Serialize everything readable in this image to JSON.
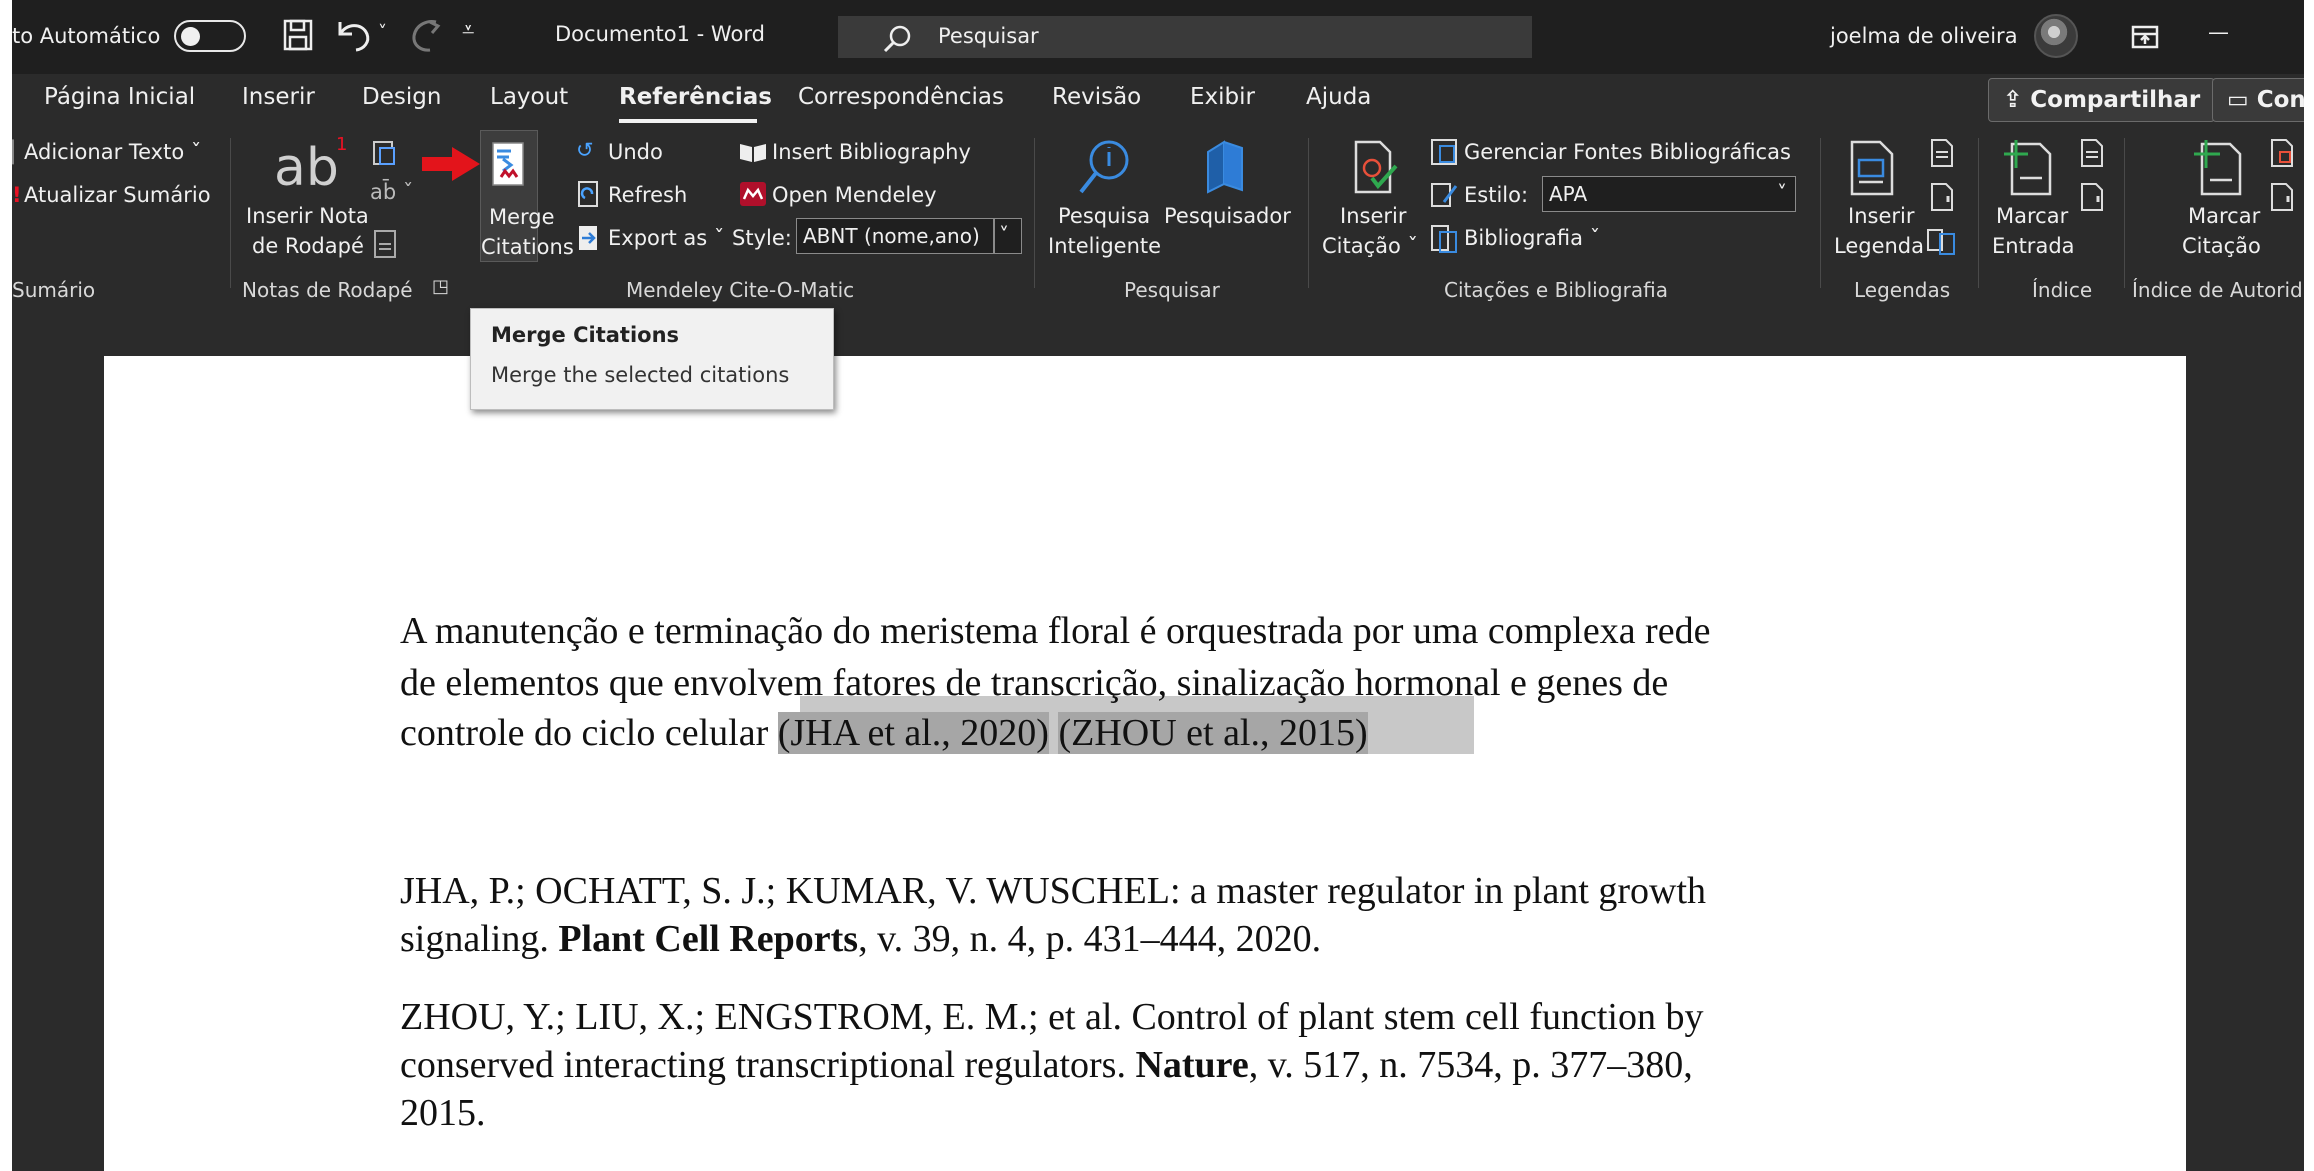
{
  "titlebar": {
    "autosave_label": "to Automático",
    "document_title": "Documento1  -  Word",
    "search_placeholder": "Pesquisar",
    "user_name": "joelma de oliveira",
    "minimize": "—"
  },
  "tabs": [
    {
      "label": "Página Inicial"
    },
    {
      "label": "Inserir"
    },
    {
      "label": "Design"
    },
    {
      "label": "Layout"
    },
    {
      "label": "Referências"
    },
    {
      "label": "Correspondências"
    },
    {
      "label": "Revisão"
    },
    {
      "label": "Exibir"
    },
    {
      "label": "Ajuda"
    }
  ],
  "share_label": "Compartilhar",
  "comments_label": "Con",
  "ribbon": {
    "sumario": {
      "add_text": "Adicionar Texto ˇ",
      "update_toc": "Atualizar Sumário",
      "group_label": "Sumário"
    },
    "notas": {
      "insert_footnote_line1": "Inserir Nota",
      "insert_footnote_line2": "de Rodapé",
      "group_label": "Notas de Rodapé"
    },
    "mendeley": {
      "merge_line1": "Merge",
      "merge_line2": "Citations",
      "undo": "Undo",
      "refresh": "Refresh",
      "export_as": "Export as ˇ",
      "insert_bibliography": "Insert Bibliography",
      "open_mendeley": "Open Mendeley",
      "style_label": "Style:",
      "style_value": "ABNT (nome,ano)",
      "group_label": "Mendeley Cite-O-Matic"
    },
    "pesquisar": {
      "smart_line1": "Pesquisa",
      "smart_line2": "Inteligente",
      "researcher": "Pesquisador",
      "group_label": "Pesquisar"
    },
    "citacoes": {
      "insert_citation_line1": "Inserir",
      "insert_citation_line2": "Citação ˇ",
      "manage_sources": "Gerenciar Fontes Bibliográficas",
      "style_label": "Estilo:",
      "style_value": "APA",
      "bibliography": "Bibliografia ˇ",
      "group_label": "Citações e Bibliografia"
    },
    "legendas": {
      "insert_caption_line1": "Inserir",
      "insert_caption_line2": "Legenda",
      "group_label": "Legendas"
    },
    "indice": {
      "mark_entry_line1": "Marcar",
      "mark_entry_line2": "Entrada",
      "group_label": "Índice"
    },
    "autoridades": {
      "mark_citation_line1": "Marcar",
      "mark_citation_line2": "Citação",
      "group_label": "Índice de Autorida"
    }
  },
  "tooltip": {
    "title": "Merge Citations",
    "description": "Merge the selected citations"
  },
  "document": {
    "para1_line1": "A manutenção e terminação do meristema floral é orquestrada por uma complexa rede",
    "para1_line2": "de elementos que envolvem fatores de transcrição, sinalização hormonal e genes de",
    "para1_line3": "controle do ciclo celular",
    "citation1": "(JHA et al., 2020)",
    "citation2": "(ZHOU et al., 2015)",
    "ref1_line1": "JHA, P.; OCHATT, S. J.; KUMAR, V. WUSCHEL: a master regulator in plant growth",
    "ref1_line2_pre": "signaling. ",
    "ref1_journal": "Plant Cell Reports",
    "ref1_line2_post": ", v. 39, n. 4, p. 431–444, 2020.",
    "ref2_line1": "ZHOU, Y.; LIU, X.; ENGSTROM, E. M.; et al. Control of plant stem cell function by",
    "ref2_line2_pre": "conserved interacting transcriptional regulators. ",
    "ref2_journal": "Nature",
    "ref2_line2_post": ", v. 517, n. 7534, p. 377–380,",
    "ref2_line3": "2015."
  }
}
